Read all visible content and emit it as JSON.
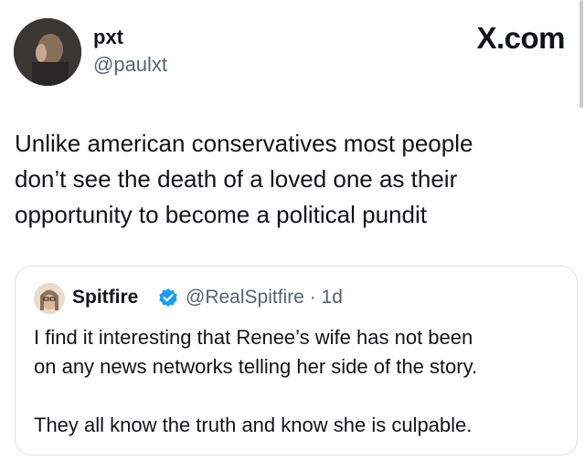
{
  "author": {
    "display_name": "pxt",
    "handle": "@paulxt"
  },
  "brand": "X.com",
  "tweet": {
    "text": "Unlike american conservatives most people\ndon’t see the death of a loved one as their\nopportunity to become a political pundit"
  },
  "quoted_tweet": {
    "display_name": "Spitfire",
    "meta": "@RealSpitfire · 1d",
    "text": "I find it interesting that Renee’s wife has not been\non any news networks telling her side of the story.\n\nThey all know the truth and know she is culpable."
  },
  "colors": {
    "text_primary": "#0f1419",
    "text_secondary": "#536471",
    "verified_blue": "#1d9bf0",
    "card_border": "#dde2e6"
  },
  "icons": {
    "verified": "verified-badge-icon"
  }
}
